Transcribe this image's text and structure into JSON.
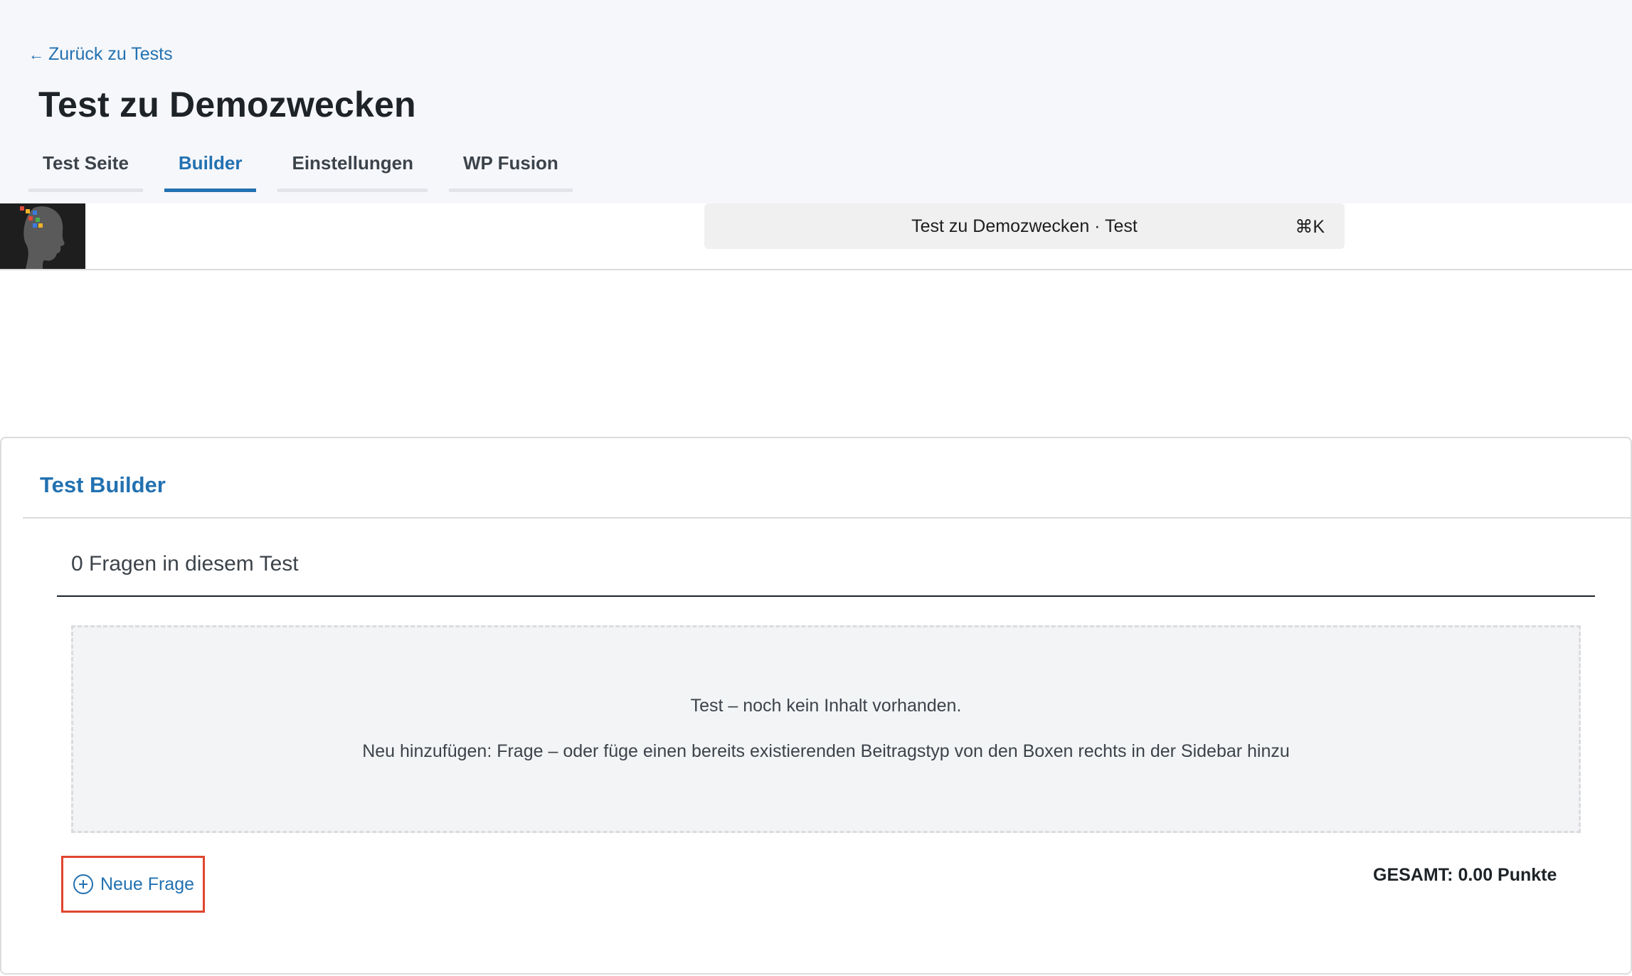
{
  "header": {
    "back_link": "Zurück zu Tests",
    "back_arrow": "←",
    "title": "Test zu Demozwecken"
  },
  "tabs": [
    {
      "label": "Test Seite",
      "active": false
    },
    {
      "label": "Builder",
      "active": true
    },
    {
      "label": "Einstellungen",
      "active": false
    },
    {
      "label": "WP Fusion",
      "active": false
    }
  ],
  "toolbar": {
    "command_title": "Test zu Demozwecken · Test",
    "shortcut": "⌘K"
  },
  "builder": {
    "title": "Test Builder",
    "question_count": "0 Fragen in diesem Test",
    "empty_line1": "Test – noch kein Inhalt vorhanden.",
    "empty_line2": "Neu hinzufügen: Frage – oder füge einen bereits existierenden Beitragstyp von den Boxen rechts in der Sidebar hinzu",
    "new_question": "Neue Frage",
    "total": "GESAMT: 0.00 Punkte"
  },
  "colors": {
    "accent": "#2271b1",
    "highlight": "#e0452f",
    "header_bg": "#f6f7fb"
  },
  "icons": {
    "back": "arrow-left-icon",
    "add": "plus-circle-icon",
    "logo": "site-logo-head-icon"
  }
}
